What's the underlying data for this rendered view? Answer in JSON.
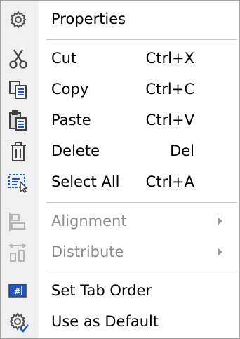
{
  "menu": {
    "items": [
      {
        "label": "Properties",
        "shortcut": "",
        "icon": "gear-icon",
        "enabled": true
      },
      {
        "label": "Cut",
        "shortcut": "Ctrl+X",
        "icon": "scissors-icon",
        "enabled": true
      },
      {
        "label": "Copy",
        "shortcut": "Ctrl+C",
        "icon": "copy-icon",
        "enabled": true
      },
      {
        "label": "Paste",
        "shortcut": "Ctrl+V",
        "icon": "paste-icon",
        "enabled": true
      },
      {
        "label": "Delete",
        "shortcut": "Del",
        "icon": "trash-icon",
        "enabled": true
      },
      {
        "label": "Select All",
        "shortcut": "Ctrl+A",
        "icon": "select-all-icon",
        "enabled": true
      },
      {
        "label": "Alignment",
        "shortcut": "",
        "icon": "align-icon",
        "enabled": false,
        "submenu": true
      },
      {
        "label": "Distribute",
        "shortcut": "",
        "icon": "distribute-icon",
        "enabled": false,
        "submenu": true
      },
      {
        "label": "Set Tab Order",
        "shortcut": "",
        "icon": "tab-order-icon",
        "enabled": true
      },
      {
        "label": "Use as Default",
        "shortcut": "",
        "icon": "gear-check-icon",
        "enabled": true
      }
    ]
  },
  "colors": {
    "accent": "#1e56c8",
    "icon_dark": "#404040",
    "disabled_text": "#8c8c8c",
    "icon_strip": "#f0f0f0",
    "separator": "#c8c8c8"
  }
}
